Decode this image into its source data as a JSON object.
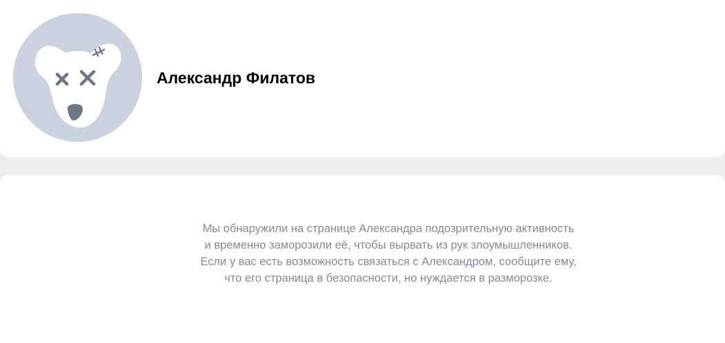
{
  "profile": {
    "name": "Александр Филатов",
    "avatar_icon": "frozen-dog-avatar-icon",
    "avatar_bg": "#cbd2dd"
  },
  "notice": {
    "text": "Мы обнаружили на странице Александра подозрительную активность и временно заморозили её, чтобы вырвать из рук злоумышленников. Если у вас есть возможность связаться с Александром, сообщите ему, что его страница в безопасности, но нуждается в разморозке.",
    "color": "#818c99"
  },
  "colors": {
    "page_bg": "#edeef0",
    "card_bg": "#ffffff"
  }
}
